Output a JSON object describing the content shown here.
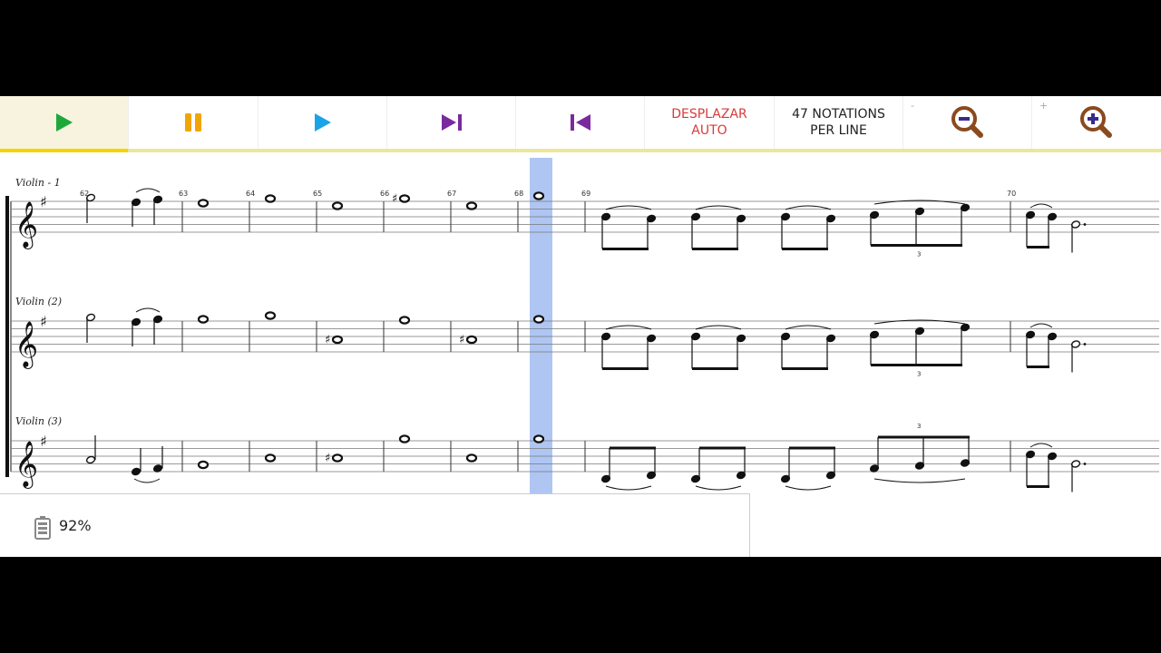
{
  "toolbar": {
    "play_label": "Play",
    "pause_label": "Pause",
    "play2_label": "Play from cursor",
    "next_label": "Skip to end",
    "prev_label": "Skip to start",
    "scroll_line1": "DESPLAZAR",
    "scroll_line2": "AUTO",
    "notations_line1": "47 NOTATIONS",
    "notations_line2": "PER LINE",
    "zoom_out_corner": "-",
    "zoom_in_corner": "+"
  },
  "score": {
    "instruments": [
      "Violin - 1",
      "Violin (2)",
      "Violin (3)"
    ],
    "measure_numbers": [
      "62",
      "63",
      "64",
      "65",
      "66",
      "67",
      "68",
      "69",
      "70"
    ],
    "tuplet_label": "3",
    "highlighted_measure": "68"
  },
  "status": {
    "battery": "92%"
  },
  "colors": {
    "play_green": "#1fa83a",
    "pause_orange": "#f2a500",
    "play_blue": "#1aa4e8",
    "nav_purple": "#7a2a9e",
    "zoom_brown": "#8a4a1e",
    "zoom_purple": "#3a2a8e",
    "highlight": "#9bb8f0",
    "active_underline": "#f2d400"
  }
}
